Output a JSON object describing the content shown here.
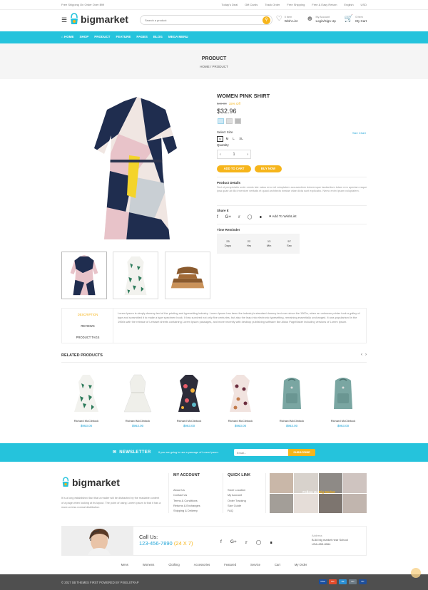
{
  "topbar": {
    "free_shipping": "Free Shipping On Order Over $99",
    "links": [
      "Today's Deal",
      "Gift Cards",
      "Track Order",
      "Free Shipping",
      "Free & Easy Return",
      "English",
      "USD"
    ]
  },
  "header": {
    "logo_text": "bigmarket",
    "search_placeholder": "Search a product",
    "icons": [
      {
        "icon": "heart-icon",
        "line1": "0 Item",
        "line2": "Wish List"
      },
      {
        "icon": "user-icon",
        "line1": "My Account",
        "line2": "Login/Sign Up"
      },
      {
        "icon": "cart-icon",
        "line1": "0 Item",
        "line2": "My Cart"
      }
    ]
  },
  "nav": {
    "items": [
      "HOME",
      "SHOP",
      "PRODUCT",
      "FEATURE",
      "PAGES",
      "BLOG",
      "MEGA MENU"
    ]
  },
  "banner": {
    "title": "PRODUCT",
    "breadcrumb": "HOME / PRODUCT"
  },
  "product": {
    "title": "WOMEN PINK SHIRT",
    "old_price": "$49.00",
    "discount": "15% Off",
    "price": "$32.96",
    "swatch_colors": [
      "#cfe9f5",
      "#dddddd",
      "#bbbbbb"
    ],
    "select_size_label": "Select Size",
    "size_chart": "Size Chart",
    "sizes": [
      "S",
      "M",
      "L",
      "XL"
    ],
    "quantity_label": "Quantity",
    "quantity_value": "1",
    "add_to_cart": "ADD TO CART",
    "buy_now": "BUY NOW",
    "details_label": "Product Details",
    "details_text": "Sed ut perspiciatis unde omnis iste natus error sit voluptatem accusantium doloremque laudantium totam rem aperiam eaque ipsa quae ab illo inventore veritatis et quasi architecto beatae vitae dicta sunt explicabo. Nemo enim ipsam voluptatem.",
    "share_label": "Share It",
    "add_wishlist": "Add To WishList",
    "timer_label": "Time Reminder",
    "timer": [
      {
        "value": "25",
        "unit": "Days"
      },
      {
        "value": "22",
        "unit": "Hrs"
      },
      {
        "value": "13",
        "unit": "Min"
      },
      {
        "value": "57",
        "unit": "Sec"
      }
    ]
  },
  "tabs": {
    "items": [
      "DESCRIPTION",
      "REVIEWS",
      "PRODUCT TAGS"
    ],
    "description": "Lorem Ipsum is simply dummy text of the printing and typesetting industry. Lorem Ipsum has been the industry's standard dummy text ever since the 1500s, when an unknown printer took a galley of type and scrambled it to make a type specimen book. It has survived not only five centuries, but also the leap into electronic typesetting, remaining essentially unchanged. It was popularised in the 1960s with the release of Letraset sheets containing Lorem Ipsum passages, and more recently with desktop publishing software like Aldus PageMaker including versions of Lorem Ipsum."
  },
  "related": {
    "title": "RELATED PRODUCTS",
    "products": [
      {
        "name": "Richard McClintock",
        "price": "$963.00",
        "kind": "dress-green"
      },
      {
        "name": "Richard McClintock",
        "price": "$963.00",
        "kind": "dress-white"
      },
      {
        "name": "Richard McClintock",
        "price": "$963.00",
        "kind": "dress-print"
      },
      {
        "name": "Richard McClintock",
        "price": "$963.00",
        "kind": "dress-floral"
      },
      {
        "name": "Richard McClintock",
        "price": "$963.00",
        "kind": "backpack"
      },
      {
        "name": "Richard McClintock",
        "price": "$963.00",
        "kind": "backpack"
      }
    ]
  },
  "newsletter": {
    "heading": "NEWSLETTER",
    "subtext": "If you are going to use a passage of Lorem Ipsum.",
    "email_placeholder": "Email...",
    "subscribe": "SUBSCRIBE"
  },
  "footer": {
    "logo_text": "bigmarket",
    "about": "It is a long established fact that a reader will be distracted by the readable content of a page when looking at its layout. The point of using Lorem Ipsum is that it has a more-or-less normal distribution",
    "my_account": {
      "title": "MY ACCOUNT",
      "items": [
        "About Us",
        "Contact Us",
        "Terms & Conditions",
        "Returns & Exchanges",
        "Shipping & Delivery"
      ]
    },
    "quick_link": {
      "title": "QUICK LINK",
      "items": [
        "Store Location",
        "My Account",
        "Order Tracking",
        "Size Guide",
        "FAQ"
      ]
    },
    "follow": "Follow Us",
    "follow_brand": "Big Market",
    "call_label": "Call Us:",
    "phone": "123-456-7890",
    "phone_hours": "(24 X 7)",
    "address_label": "Address",
    "address_line1": "B-58 big market near School",
    "address_line2": "USA-653-8964",
    "bottom_nav": [
      "Mens",
      "Womens",
      "Clothing",
      "Accessories",
      "Featured",
      "Service",
      "Cart",
      "My Order"
    ],
    "copyright": "© 2017 SB THEMES FIRST POWERED BY PIXELSTRAP",
    "payments": [
      {
        "name": "VISA",
        "color": "#1a4fa0"
      },
      {
        "name": "MC",
        "color": "#e24b2b"
      },
      {
        "name": "AE",
        "color": "#2b8fd3"
      },
      {
        "name": "DC",
        "color": "#6d7b86"
      },
      {
        "name": "PP",
        "color": "#1f4f9a"
      }
    ]
  },
  "colors": {
    "accent": "#25c3dc",
    "button": "#f6b51b",
    "link": "#25a6d8"
  }
}
